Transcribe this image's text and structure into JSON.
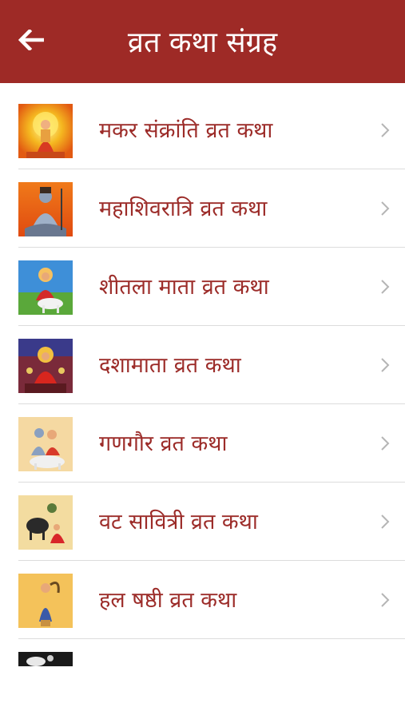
{
  "header": {
    "title": "व्रत कथा संग्रह",
    "back_icon": "arrow-left-icon",
    "background": "#9e2a26"
  },
  "list": {
    "items": [
      {
        "label": "मकर संक्रांति व्रत कथा"
      },
      {
        "label": "महाशिवरात्रि व्रत कथा"
      },
      {
        "label": "शीतला माता व्रत कथा"
      },
      {
        "label": "दशामाता व्रत कथा"
      },
      {
        "label": "गणगौर व्रत कथा"
      },
      {
        "label": "वट सावित्री व्रत कथा"
      },
      {
        "label": "हल षष्ठी व्रत कथा"
      }
    ],
    "label_color": "#9c2c29",
    "chevron_icon": "chevron-right-icon"
  }
}
